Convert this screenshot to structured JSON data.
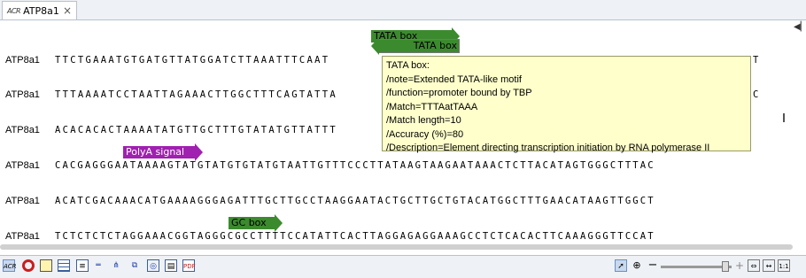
{
  "tab": {
    "icon": "sequence-icon",
    "icon_label": "ACR",
    "title": "ATP8a1",
    "close": "×"
  },
  "rows": [
    {
      "name": "ATP8a1",
      "seq": "TTCTGAAATGTGATGTTATGGATCTTAAATTTCAAT",
      "tail": "T"
    },
    {
      "name": "ATP8a1",
      "seq": "TTTAAAATCCTAATTAGAAACTTGGCTTTCAGTATTA",
      "tail": "C"
    },
    {
      "name": "ATP8a1",
      "seq": "ACACACACTAAAATATGTTGCTTTGTATATGTTATTT",
      "tail": ""
    },
    {
      "name": "ATP8a1",
      "seq": "CACGAGGGAATAAAAGTATGTATGTGTATGTAATTGTTTCCCTTATAAGTAAGAATAAACTCTTACATAGTGGGCTTTAC",
      "tail": ""
    },
    {
      "name": "ATP8a1",
      "seq": "ACATCGACAAACATGAAAAGGGAGATTTGCTTGCCTAAGGAATACTGCTTGCTGTACATGGCTTTGAACATAAGTTGGCT",
      "tail": ""
    },
    {
      "name": "ATP8a1",
      "seq": "TCTCTCTCTAGGAAACGGTAGGGCGCCTTTTCCATATTCACTTAGGAGAGGAAAGCCTCTCACACTTCAAAGGGTTCCAT",
      "tail": ""
    }
  ],
  "annotations": [
    {
      "label": "TATA box",
      "color": "#3c8a2e",
      "direction": "forward",
      "selected": false
    },
    {
      "label": "TATA box",
      "color": "#3c8a2e",
      "direction": "reverse",
      "selected": true
    },
    {
      "label": "PolyA signal",
      "color": "#a020b0",
      "direction": "forward",
      "selected": false
    },
    {
      "label": "GC box",
      "color": "#3c8a2e",
      "direction": "forward",
      "selected": false
    }
  ],
  "tooltip": [
    "TATA box:",
    "/note=Extended TATA-like motif",
    "/function=promoter bound by TBP",
    "/Match=TTTAatTAAA",
    "/Match length=10",
    "/Accuracy (%)=80",
    "/Description=Element directing transcription initiation by RNA polymerase II"
  ],
  "toolbar_icons": [
    "sequence-view-icon",
    "record-icon",
    "graphical-icon",
    "table-icon",
    "text-icon",
    "restriction-icon",
    "primer-icon",
    "history-icon",
    "structure-icon",
    "document-icon",
    "export-icon"
  ],
  "zoom": {
    "tools": [
      "pointer-icon",
      "zoom-in-icon",
      "zoom-minus-icon",
      "zoom-plus-icon",
      "fit-width-icon",
      "fit-all-icon",
      "zoom-100-icon"
    ],
    "level": 0.9
  }
}
